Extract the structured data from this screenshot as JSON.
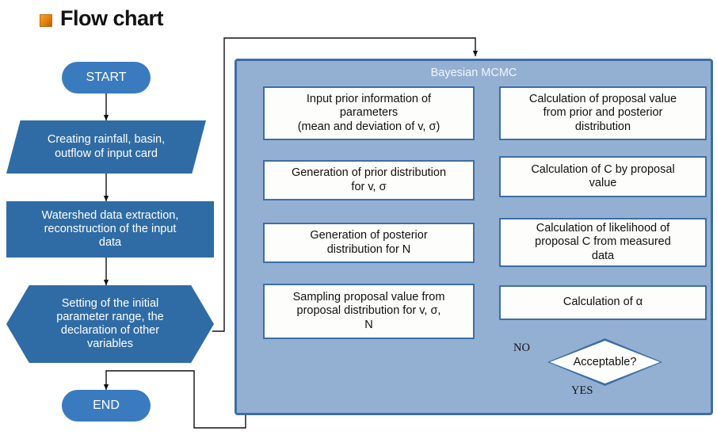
{
  "page": {
    "title": "Flow chart",
    "title_icon": "orange-square-icon"
  },
  "colors": {
    "dark_shape": "#2f6ca5",
    "terminator": "#3a7bbf",
    "panel_bg": "#93b0d3",
    "panel_border": "#3d6ea5",
    "box_bg": "#fdfdfb",
    "box_border": "#3d6ea5",
    "connector": "#1a1a1a",
    "title_text": "#121212"
  },
  "main_flow": {
    "start": "START",
    "create_input_card": "Creating rainfall, basin,\noutflow of input card",
    "watershed_extraction": "Watershed data extraction,\nreconstruction of the input\ndata",
    "initial_setting": "Setting of the initial\nparameter range, the\ndeclaration of other\nvariables",
    "end": "END"
  },
  "mcmc": {
    "title": "Bayesian MCMC",
    "left_column": [
      {
        "id": "input-prior-information",
        "label": "Input prior information of\nparameters\n(mean and deviation of  v, σ)"
      },
      {
        "id": "generation-prior-distribution",
        "label": "Generation of prior distribution\nfor v, σ"
      },
      {
        "id": "generation-posterior-distribution",
        "label": "Generation of posterior\ndistribution for N"
      },
      {
        "id": "sampling-proposal-value",
        "label": "Sampling proposal value from\nproposal distribution for  v, σ,\nN"
      }
    ],
    "right_column": [
      {
        "id": "calculation-proposal-value",
        "label": "Calculation of proposal value\nfrom prior and posterior\ndistribution"
      },
      {
        "id": "calculation-c-by-proposal",
        "label": "Calculation of C by proposal\nvalue"
      },
      {
        "id": "calculation-likelihood",
        "label": "Calculation of likelihood of\nproposal C from measured\ndata"
      },
      {
        "id": "calculation-alpha",
        "label": "Calculation of α"
      }
    ],
    "decision": {
      "label": "Acceptable?",
      "branch_no": "NO",
      "branch_yes": "YES"
    }
  }
}
